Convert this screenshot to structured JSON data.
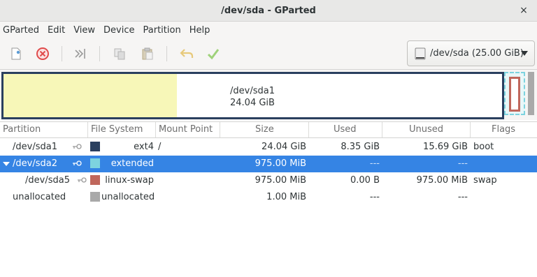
{
  "window": {
    "title": "/dev/sda - GParted",
    "close": "×"
  },
  "menu": [
    "GParted",
    "Edit",
    "View",
    "Device",
    "Partition",
    "Help"
  ],
  "toolbar": {
    "icons": [
      "new-icon",
      "delete-icon",
      "resize-move-icon",
      "copy-icon",
      "paste-icon",
      "undo-icon",
      "apply-icon"
    ],
    "device_select": "/dev/sda (25.00 GiB)"
  },
  "diskmap": {
    "name": "/dev/sda1",
    "size": "24.04 GiB",
    "used_fraction": 0.348
  },
  "columns": [
    "Partition",
    "File System",
    "Mount Point",
    "Size",
    "Used",
    "Unused",
    "Flags"
  ],
  "rows": [
    {
      "partition": "/dev/sda1",
      "fs": "ext4",
      "fs_color": "#2a3f5f",
      "mount": "/",
      "size": "24.04 GiB",
      "used": "8.35 GiB",
      "unused": "15.69 GiB",
      "flags": "boot"
    },
    {
      "partition": "/dev/sda2",
      "fs": "extended",
      "fs_color": "#7dd3df",
      "mount": "",
      "size": "975.00 MiB",
      "used": "---",
      "unused": "---",
      "flags": ""
    },
    {
      "partition": "/dev/sda5",
      "fs": "linux-swap",
      "fs_color": "#c0675c",
      "mount": "",
      "size": "975.00 MiB",
      "used": "0.00 B",
      "unused": "975.00 MiB",
      "flags": "swap"
    },
    {
      "partition": "unallocated",
      "fs": "unallocated",
      "fs_color": "#a9a9a9",
      "mount": "",
      "size": "1.00 MiB",
      "used": "---",
      "unused": "---",
      "flags": ""
    }
  ]
}
